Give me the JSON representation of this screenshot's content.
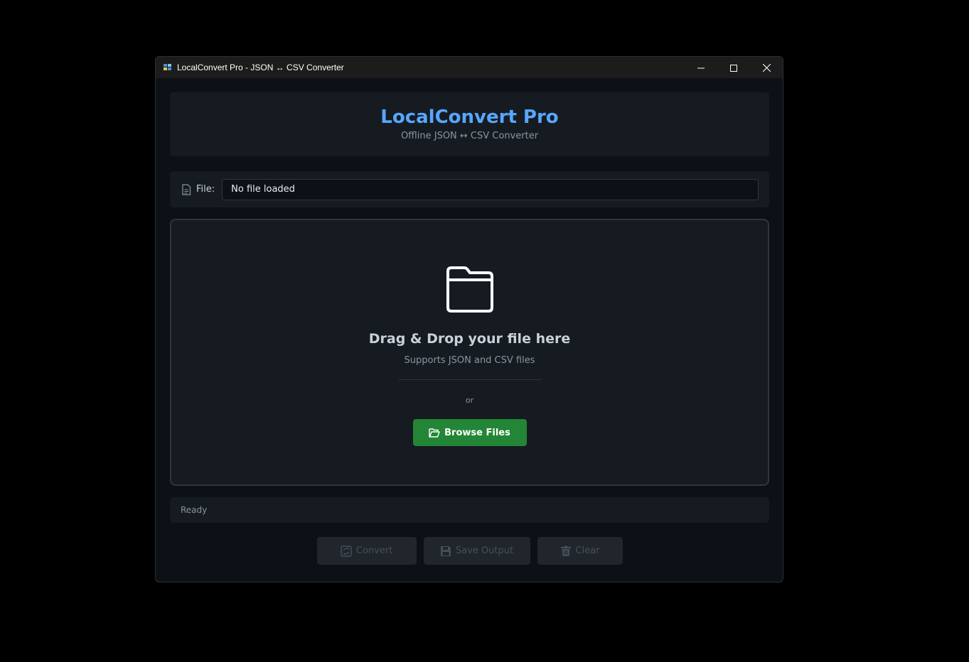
{
  "window": {
    "title": "LocalConvert Pro - JSON ↔ CSV Converter",
    "controls": {
      "minimize": "minimize-icon",
      "maximize": "maximize-icon",
      "close": "close-icon"
    }
  },
  "header": {
    "title": "LocalConvert Pro",
    "subtitle": "Offline JSON ↔ CSV Converter"
  },
  "file": {
    "label": "File:",
    "value": "No file loaded",
    "icon": "document-icon"
  },
  "drop_zone": {
    "icon": "folder-icon",
    "title": "Drag & Drop your file here",
    "subtitle": "Supports JSON and CSV files",
    "or_text": "or",
    "browse_label": "Browse Files",
    "browse_icon": "folder-open-icon"
  },
  "status": {
    "text": "Ready"
  },
  "actions": {
    "convert_label": "Convert",
    "save_label": "Save Output",
    "clear_label": "Clear"
  },
  "colors": {
    "accent": "#58a6ff",
    "browse_button": "#238636",
    "background": "#0d1117",
    "card": "#161b22",
    "disabled_text": "#484f58"
  }
}
